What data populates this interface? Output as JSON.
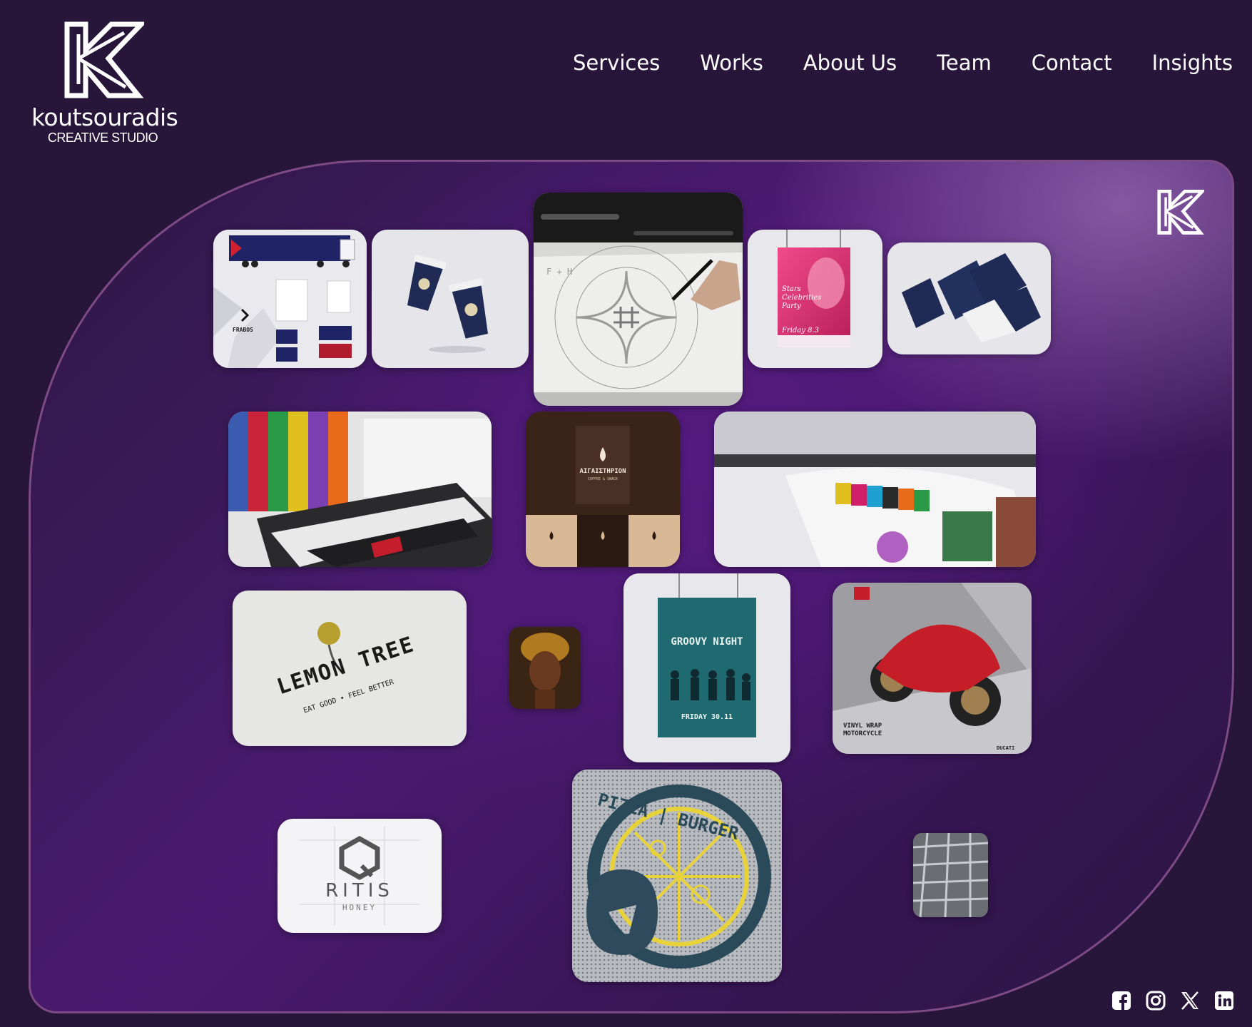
{
  "brand": {
    "name": "koutsouradis",
    "subtitle": "CREATIVE STUDIO"
  },
  "nav": {
    "items": [
      {
        "label": "Services"
      },
      {
        "label": "Works"
      },
      {
        "label": "About Us"
      },
      {
        "label": "Team"
      },
      {
        "label": "Contact"
      },
      {
        "label": "Insights"
      }
    ]
  },
  "portfolio": {
    "tiles": [
      {
        "title": "FRABOS",
        "subject": "truck-branding-stationery"
      },
      {
        "title": "",
        "subject": "coffee-cups-mockup"
      },
      {
        "title": "F + H",
        "subject": "logo-sketch-drawing"
      },
      {
        "title": "Stars Celebrities Party",
        "date": "Friday 8.3",
        "subject": "party-poster"
      },
      {
        "title": "",
        "subject": "brochure-mockup"
      },
      {
        "title": "",
        "subject": "print-shop-interior"
      },
      {
        "title": "ΑΙΓΑΙΣΤΗΡΙΟΝ",
        "tagline": "COFFEE & SNACK",
        "subject": "coffee-branding"
      },
      {
        "title": "",
        "subject": "large-format-printer"
      },
      {
        "title": "LEMON TREE",
        "tagline": "EAT GOOD • FEEL BETTER",
        "subject": "lemon-tree-logo"
      },
      {
        "title": "",
        "subject": "portrait-illustration"
      },
      {
        "title": "GROOVY NIGHT",
        "date": "FRIDAY 30.11",
        "subject": "groovy-night-poster"
      },
      {
        "title": "VINYL WRAP MOTORCYCLE",
        "brand": "DUCATI",
        "subject": "motorcycle-wrap"
      },
      {
        "title": "RITIS",
        "tagline": "HONEY",
        "subject": "ritis-honey-logo"
      },
      {
        "title": "PIZZA | BURGER",
        "subject": "pizza-burger-sign"
      },
      {
        "title": "",
        "subject": "printed-sheets-closeup"
      }
    ]
  },
  "colors": {
    "background": "#271639",
    "panel_accent": "#541a80",
    "panel_border": "#7e4a86"
  },
  "social": [
    {
      "icon": "facebook-icon"
    },
    {
      "icon": "instagram-icon"
    },
    {
      "icon": "x-icon"
    },
    {
      "icon": "linkedin-icon"
    }
  ]
}
